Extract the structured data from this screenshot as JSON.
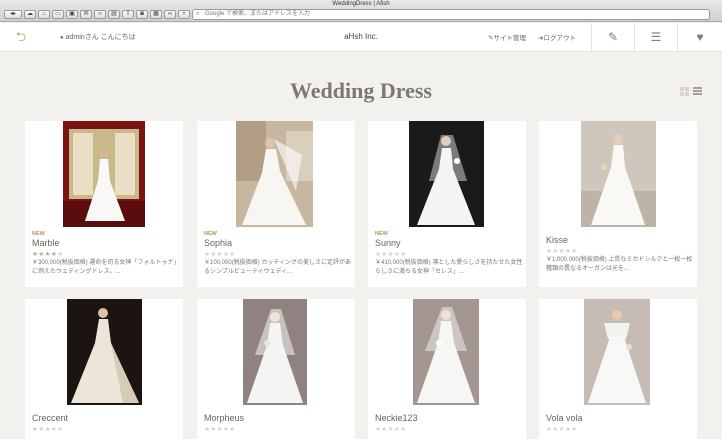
{
  "browser": {
    "window_title": "WeddingDress | Afish",
    "address_placeholder": "Google で検索、またはアドレスを入力"
  },
  "header": {
    "greeting": "adminさん こんにちは",
    "brand": "aHsh Inc.",
    "site_admin": "サイト管理",
    "logout": "ログアウト"
  },
  "page": {
    "title": "Wedding Dress"
  },
  "colors": {
    "accent": "#b49366",
    "background": "#f3f1ee"
  },
  "products": [
    {
      "new": "NEW",
      "name": "Marble",
      "rating": 4,
      "desc": "￥300,000(税抜価格) 運命を司る女神「フォルトゥナ」に例えたウェディングドレス。..."
    },
    {
      "new": "NEW",
      "name": "Sophia",
      "rating": 0,
      "desc": "￥100,000(税抜価格) カッティングの美しさに定評があるシンプルビューティウェディ..."
    },
    {
      "new": "NEW",
      "name": "Sunny",
      "rating": 0,
      "desc": "￥410,000(税抜価格) 凛とした愛らしさを持たせた女性らしさに満ちる女神「セレス」..."
    },
    {
      "new": "",
      "name": "Kisse",
      "rating": 0,
      "desc": "￥1,000,000(税抜価格) 上質なミカドシルクと一枚一枚種類の異なるオーガンは光を..."
    },
    {
      "new": "",
      "name": "Crecсent",
      "rating": 0,
      "desc": ""
    },
    {
      "new": "",
      "name": "Morpheus",
      "rating": 0,
      "desc": ""
    },
    {
      "new": "",
      "name": "Neckie123",
      "rating": 0,
      "desc": ""
    },
    {
      "new": "",
      "name": "Vola vola",
      "rating": 0,
      "desc": ""
    }
  ]
}
